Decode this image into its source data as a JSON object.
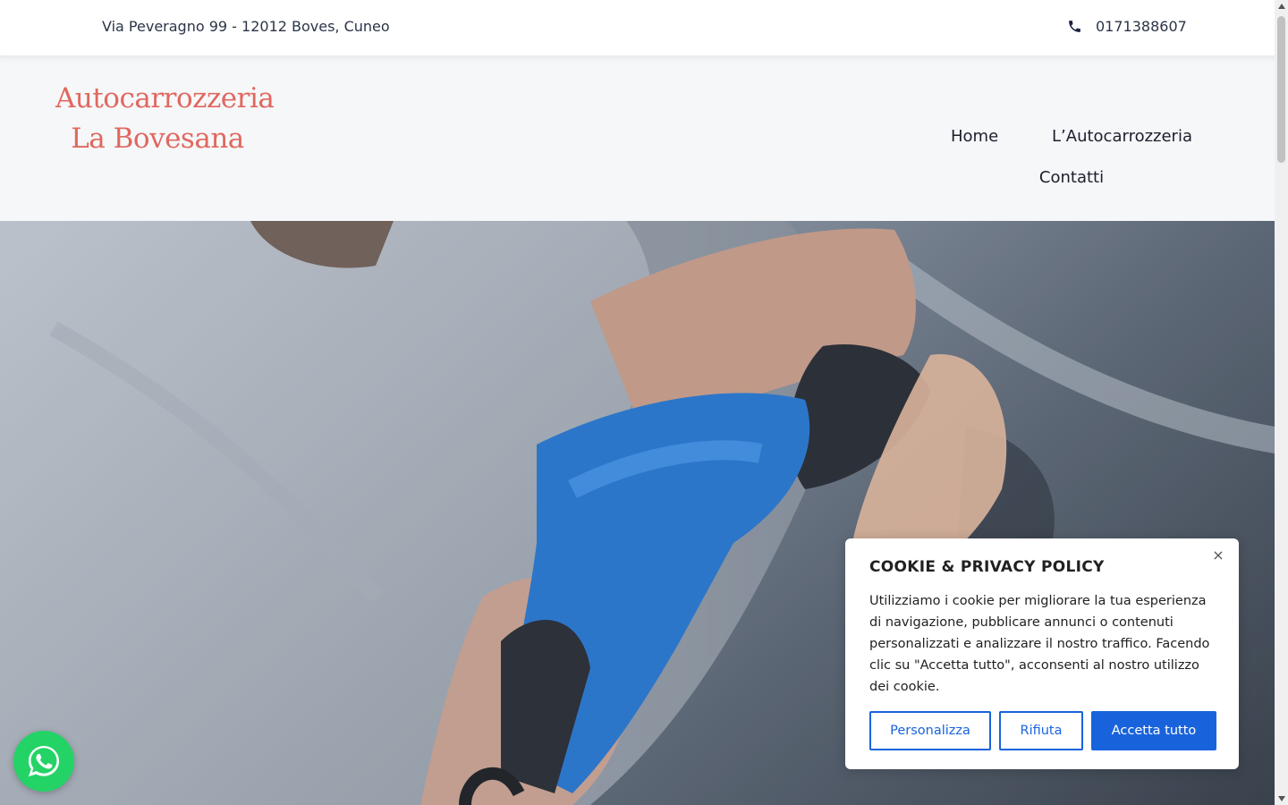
{
  "topbar": {
    "address": "Via Peveragno 99 - 12012 Boves, Cuneo",
    "phone": "0171388607"
  },
  "logo": {
    "line1": "Autocarrozzeria",
    "line2": "La Bovesana",
    "color": "#e0685f"
  },
  "nav": {
    "items": [
      {
        "label": "Home"
      },
      {
        "label": "L’Autocarrozzeria"
      },
      {
        "label": "Contatti"
      }
    ]
  },
  "cookie": {
    "title": "COOKIE & PRIVACY POLICY",
    "close_label": "×",
    "text": "Utilizziamo i cookie per migliorare la tua esperienza di navigazione, pubblicare annunci o contenuti personalizzati e analizzare il nostro traffico. Facendo clic su \"Accetta tutto\", acconsenti al nostro utilizzo dei cookie.",
    "customize_label": "Personalizza",
    "reject_label": "Rifiuta",
    "accept_label": "Accetta tutto",
    "accent": "#1863dc"
  },
  "icons": {
    "phone": "phone-icon",
    "whatsapp": "whatsapp-icon",
    "close": "close-icon"
  },
  "colors": {
    "whatsapp": "#24d366",
    "header_bg": "#f6f7f9"
  }
}
